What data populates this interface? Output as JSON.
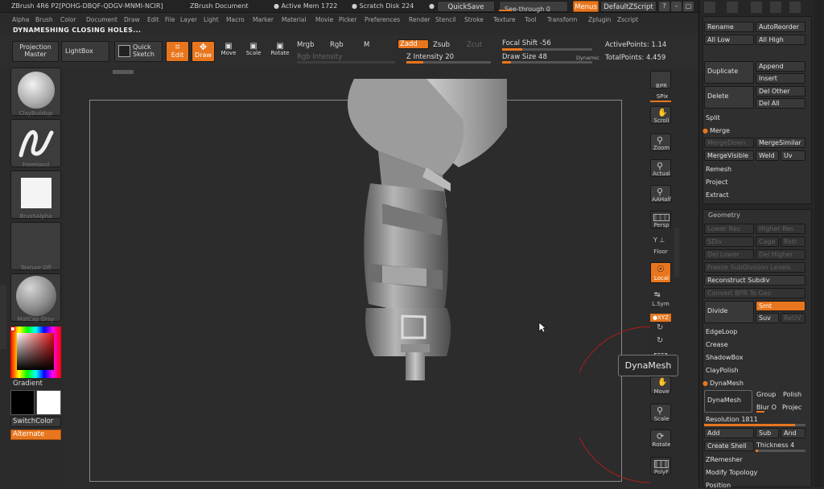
{
  "title": {
    "app": "ZBrush 4R6 P2[POHG-DBQF-QDGV-MNMI-NCIR]",
    "document": "ZBrush Document",
    "active_mem": "● Active Mem 1722",
    "scratch": "● Scratch Disk 224",
    "rtime": "●",
    "quicksave": "QuickSave",
    "seethrough": "See-through  0",
    "menus": "Menus",
    "zscript": "DefaultZScript"
  },
  "menubar": [
    "Alpha",
    "Brush",
    "Color",
    "Document",
    "Draw",
    "Edit",
    "File",
    "Layer",
    "Light",
    "Macro",
    "Marker",
    "Material",
    "Movie",
    "Picker",
    "Preferences",
    "Render",
    "Stencil",
    "Stroke",
    "Texture",
    "Tool",
    "Transform",
    "Zplugin",
    "Zscript"
  ],
  "status": "DYNAMESHING CLOSING HOLES...",
  "shelf": {
    "projection_master": [
      "Projection",
      "Master"
    ],
    "lightbox": "LightBox",
    "quick_sketch": [
      "Quick",
      "Sketch"
    ],
    "edit": "Edit",
    "draw": "Draw",
    "move": "Move",
    "scale": "Scale",
    "rotate": "Rotate",
    "mrgb": "Mrgb",
    "rgb": "Rgb",
    "m": "M",
    "rgb_intensity": "Rgb  Intensity",
    "zadd": "Zadd",
    "zsub": "Zsub",
    "zcut": "Zcut",
    "z_intensity": "Z Intensity 20",
    "focal_shift": "Focal Shift -56",
    "draw_size": "Draw Size 48",
    "dynamic": "Dynamic",
    "active_points": "ActivePoints: 1.14",
    "total_points": "TotalPoints: 4.459"
  },
  "left_tray": {
    "brush": "ClayBuildup",
    "stroke": "FreeHand",
    "alpha": "BrushAlpha",
    "texture": "Texture  Off",
    "material": "MatCap  Gray",
    "gradient": "Gradient",
    "switch_color": "SwitchColor",
    "alternate": "Alternate"
  },
  "right_tools": {
    "bpr": "BPR",
    "spix": "SPix",
    "scroll": "Scroll",
    "zoom": "Zoom",
    "actual": "Actual",
    "aahalf": "AAHalf",
    "persp": "Persp",
    "floor": "Floor",
    "local": "Local",
    "lsym": "L.Sym",
    "xyz": "●XYZ",
    "frame": "Frame",
    "move": "Move",
    "scale": "Scale",
    "rotate": "Rotate",
    "polyf": "PolyF"
  },
  "tooltip": "DynaMesh",
  "subtool": {
    "rename": "Rename",
    "autoreorder": "AutoReorder",
    "all_low": "All Low",
    "all_high": "All High",
    "duplicate": "Duplicate",
    "append": "Append",
    "insert": "Insert",
    "delete": "Delete",
    "del_other": "Del Other",
    "del_all": "Del All",
    "split": "Split",
    "merge": "Merge",
    "merge_down": "MergeDown",
    "merge_similar": "MergeSimilar",
    "merge_visible": "MergeVisible",
    "weld": "Weld",
    "uv": "Uv",
    "remesh": "Remesh",
    "project": "Project",
    "extract": "Extract"
  },
  "geometry": {
    "header": "Geometry",
    "lower_res": "Lower Res",
    "higher_res": "Higher Res",
    "sdiv": "SDiv",
    "cage": "Cage",
    "rstr": "Rstr",
    "del_lower": "Del Lower",
    "del_higher": "Del Higher",
    "freeze_subdivision": "Freeze SubDivision Levels",
    "reconstruct_subdiv": "Reconstruct Subdiv",
    "convert_bpr": "Convert BPR To Geo",
    "divide": "Divide",
    "smt": "Smt",
    "suv": "Suv",
    "reuv": "ReUV",
    "edgeloop": "EdgeLoop",
    "crease": "Crease",
    "shadowbox": "ShadowBox",
    "claypolish": "ClayPolish",
    "dynamesh_hdr": "DynaMesh",
    "dynamesh_btn": "DynaMesh",
    "group": "Group",
    "polish": "Polish",
    "blur": "Blur O",
    "projec": "Projec",
    "resolution": "Resolution 1811",
    "add": "Add",
    "sub": "Sub",
    "and": "And",
    "create_shell": "Create Shell",
    "thickness": "Thickness 4",
    "zremesher": "ZRemesher",
    "modify_topology": "Modify Topology",
    "position": "Position"
  },
  "colors": {
    "accent": "#e8761e",
    "bg": "#2b2b2b",
    "panel": "#262626"
  },
  "sliders": {
    "z_intensity": 0.2,
    "focal_shift": 0.22,
    "draw_size": 0.1,
    "resolution": 0.9,
    "thickness": 0.05
  }
}
